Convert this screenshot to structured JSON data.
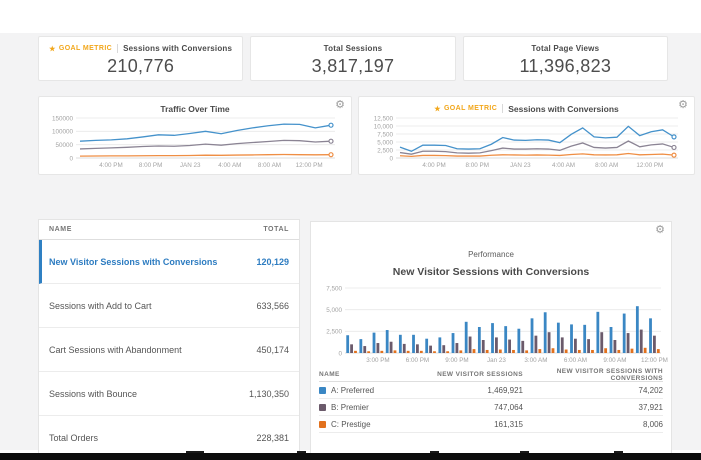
{
  "colors": {
    "line_blue": "#4592cb",
    "line_gray": "#8b8494",
    "line_orange": "#ef8e44",
    "bar_blue": "#3a87c4",
    "bar_purple": "#6b5a6b",
    "bar_orange": "#e2711d",
    "goal": "#f2a71b",
    "selected": "#2d7cc1"
  },
  "goal_metric_label": "GOAL METRIC",
  "kpi_cards": [
    {
      "goal": true,
      "label": "Sessions with Conversions",
      "value": "210,776"
    },
    {
      "goal": false,
      "label": "Total Sessions",
      "value": "3,817,197"
    },
    {
      "goal": false,
      "label": "Total Page Views",
      "value": "11,396,823"
    }
  ],
  "chart_data": [
    {
      "id": "traffic",
      "type": "line",
      "title": "Traffic Over Time",
      "ymax": 150000,
      "grid": true,
      "legend": "none",
      "yticks": [
        {
          "v": 150000,
          "label": "150000"
        },
        {
          "v": 100000,
          "label": "100000"
        },
        {
          "v": 50000,
          "label": "50000"
        },
        {
          "v": 0,
          "label": "0"
        }
      ],
      "xticks": [
        "4:00 PM",
        "8:00 PM",
        "JAN 23",
        "4:00 AM",
        "8:00 AM",
        "12:00 PM"
      ],
      "series": [
        {
          "name": "total-sessions",
          "color": "#4592cb",
          "values": [
            63000,
            66000,
            68000,
            72000,
            79000,
            87000,
            85000,
            92000,
            100000,
            91000,
            103000,
            113000,
            121000,
            127000,
            126000,
            113000,
            123000
          ]
        },
        {
          "name": "secondary-sessions",
          "color": "#8b8494",
          "values": [
            34000,
            36000,
            38000,
            40000,
            43000,
            45000,
            44000,
            47000,
            52000,
            48000,
            54000,
            58000,
            62000,
            66000,
            65000,
            60000,
            63000
          ]
        },
        {
          "name": "conversions",
          "color": "#ef8e44",
          "values": [
            7000,
            7500,
            8000,
            8000,
            8500,
            9000,
            9000,
            9500,
            10500,
            10000,
            11000,
            11500,
            12500,
            13000,
            12500,
            12000,
            12500
          ]
        }
      ]
    },
    {
      "id": "conversions",
      "type": "line",
      "title": "Sessions with Conversions",
      "goal_metric": true,
      "ymax": 12500,
      "grid": true,
      "legend": "none",
      "yticks": [
        {
          "v": 12500,
          "label": "12,500"
        },
        {
          "v": 10000,
          "label": "10,000"
        },
        {
          "v": 7500,
          "label": "7,500"
        },
        {
          "v": 5000,
          "label": "5,000"
        },
        {
          "v": 2500,
          "label": "2,500"
        },
        {
          "v": 0,
          "label": "0"
        }
      ],
      "xticks": [
        "4:00 PM",
        "8:00 PM",
        "JAN 23",
        "4:00 AM",
        "8:00 AM",
        "12:00 PM"
      ],
      "series": [
        {
          "name": "sessions-with-conversions",
          "color": "#4592cb",
          "values": [
            3400,
            2100,
            4000,
            4000,
            3900,
            2900,
            2800,
            2900,
            4300,
            6400,
            5600,
            5500,
            5700,
            5600,
            4800,
            7400,
            9400,
            6600,
            6300,
            6500,
            9900,
            7000,
            8200,
            8800,
            6600
          ]
        },
        {
          "name": "secondary",
          "color": "#8b8494",
          "values": [
            1700,
            1200,
            2100,
            2100,
            2000,
            1600,
            1500,
            1600,
            2300,
            3100,
            2800,
            2800,
            2900,
            2800,
            2400,
            3700,
            4700,
            3300,
            3100,
            3300,
            5300,
            3500,
            4100,
            4400,
            3300
          ]
        },
        {
          "name": "tertiary",
          "color": "#ef8e44",
          "values": [
            700,
            500,
            800,
            800,
            750,
            600,
            600,
            600,
            850,
            1000,
            950,
            900,
            950,
            900,
            800,
            1100,
            1300,
            1000,
            950,
            1000,
            1400,
            1000,
            1100,
            1200,
            900
          ]
        }
      ]
    },
    {
      "id": "performance-bars",
      "type": "bar",
      "title": "New Visitor Sessions with Conversions",
      "subtitle": "Performance",
      "ymax": 7500,
      "grid": true,
      "legend": "table-below",
      "yticks": [
        {
          "v": 7500,
          "label": "7,500"
        },
        {
          "v": 5000,
          "label": "5,000"
        },
        {
          "v": 2500,
          "label": "2,500"
        },
        {
          "v": 0,
          "label": "0"
        }
      ],
      "xticks": [
        "3:00 PM",
        "6:00 PM",
        "9:00 PM",
        "Jan 23",
        "3:00 AM",
        "6:00 AM",
        "9:00 AM",
        "12:00 PM"
      ],
      "series": [
        {
          "name": "A: Preferred",
          "color": "#3a87c4",
          "values": [
            2050,
            1600,
            2350,
            2650,
            2100,
            2100,
            1650,
            1800,
            2300,
            3600,
            3000,
            3450,
            3100,
            2800,
            4000,
            4700,
            3500,
            3300,
            3250,
            4750,
            3000,
            4550,
            5400,
            4000
          ]
        },
        {
          "name": "B: Premier",
          "color": "#6b5a6b",
          "values": [
            1000,
            800,
            1150,
            1300,
            1050,
            1000,
            850,
            900,
            1150,
            1900,
            1500,
            1800,
            1550,
            1400,
            2000,
            2400,
            1800,
            1650,
            1600,
            2400,
            1500,
            2300,
            2700,
            2000
          ]
        },
        {
          "name": "C: Prestige",
          "color": "#e2711d",
          "values": [
            250,
            200,
            250,
            300,
            250,
            250,
            200,
            200,
            300,
            450,
            350,
            400,
            350,
            300,
            450,
            550,
            400,
            350,
            350,
            550,
            350,
            500,
            600,
            450
          ]
        }
      ]
    }
  ],
  "traffic_card": {
    "title": "Traffic Over Time"
  },
  "conversions_card": {
    "title": "Sessions with Conversions"
  },
  "left_table": {
    "columns": {
      "name": "NAME",
      "total": "TOTAL"
    },
    "rows": [
      {
        "name": "New Visitor Sessions with Conversions",
        "total": "120,129",
        "selected": true
      },
      {
        "name": "Sessions with Add to Cart",
        "total": "633,566",
        "selected": false
      },
      {
        "name": "Cart Sessions with Abandonment",
        "total": "450,174",
        "selected": false
      },
      {
        "name": "Sessions with Bounce",
        "total": "1,130,350",
        "selected": false
      },
      {
        "name": "Total Orders",
        "total": "228,381",
        "selected": false
      }
    ]
  },
  "performance_panel": {
    "subtitle": "Performance",
    "title": "New Visitor Sessions with Conversions",
    "table": {
      "columns": {
        "name": "NAME",
        "sessions": "NEW VISITOR SESSIONS",
        "conversions": "NEW VISITOR SESSIONS WITH CONVERSIONS"
      },
      "rows": [
        {
          "name": "A: Preferred",
          "color": "#3a87c4",
          "sessions": "1,469,921",
          "conversions": "74,202"
        },
        {
          "name": "B: Premier",
          "color": "#6b5a6b",
          "sessions": "747,064",
          "conversions": "37,921"
        },
        {
          "name": "C: Prestige",
          "color": "#e2711d",
          "sessions": "161,315",
          "conversions": "8,006"
        }
      ]
    }
  }
}
